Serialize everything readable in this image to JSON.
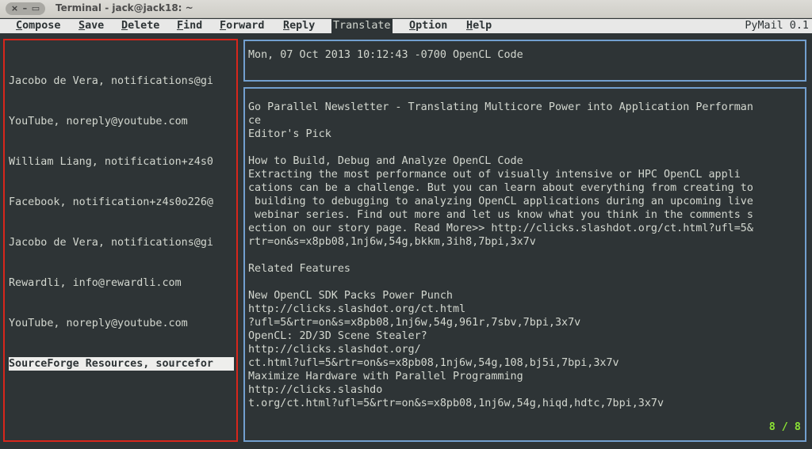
{
  "window": {
    "title": "Terminal - jack@jack18: ~",
    "buttons": {
      "close": "×",
      "minimize": "–",
      "maximize": "▭"
    }
  },
  "menubar": {
    "items": [
      {
        "first": "C",
        "rest": "ompose"
      },
      {
        "first": "S",
        "rest": "ave"
      },
      {
        "first": "D",
        "rest": "elete"
      },
      {
        "first": "F",
        "rest": "ind"
      },
      {
        "first": "F",
        "rest": "orward"
      },
      {
        "first": "R",
        "rest": "eply"
      },
      {
        "label": "Translate"
      },
      {
        "first": "O",
        "rest": "ption"
      },
      {
        "first": "H",
        "rest": "elp"
      }
    ],
    "app_name": "PyMail 0.1"
  },
  "inbox": {
    "items": [
      "Jacobo de Vera, notifications@gi",
      "YouTube, noreply@youtube.com",
      "William Liang, notification+z4s0",
      "Facebook, notification+z4s0o226@",
      "Jacobo de Vera, notifications@gi",
      "Rewardli, info@rewardli.com",
      "YouTube, noreply@youtube.com",
      "SourceForge Resources, sourcefor"
    ],
    "selected_index": 7
  },
  "message": {
    "header": "Mon, 07 Oct 2013 10:12:43 -0700 OpenCL Code",
    "body_lines": [
      "Go Parallel Newsletter - Translating Multicore Power into Application Performan",
      "ce",
      "Editor's Pick",
      "",
      "How to Build, Debug and Analyze OpenCL Code",
      "Extracting the most performance out of visually intensive or HPC OpenCL appli",
      "cations can be a challenge. But you can learn about everything from creating to",
      " building to debugging to analyzing OpenCL applications during an upcoming live",
      " webinar series. Find out more and let us know what you think in the comments s",
      "ection on our story page. Read More>> http://clicks.slashdot.org/ct.html?ufl=5&",
      "rtr=on&s=x8pb08,1nj6w,54g,bkkm,3ih8,7bpi,3x7v",
      "",
      "Related Features",
      "",
      "New OpenCL SDK Packs Power Punch",
      "http://clicks.slashdot.org/ct.html",
      "?ufl=5&rtr=on&s=x8pb08,1nj6w,54g,961r,7sbv,7bpi,3x7v",
      "OpenCL: 2D/3D Scene Stealer?",
      "http://clicks.slashdot.org/",
      "ct.html?ufl=5&rtr=on&s=x8pb08,1nj6w,54g,108,bj5i,7bpi,3x7v",
      "Maximize Hardware with Parallel Programming",
      "http://clicks.slashdo",
      "t.org/ct.html?ufl=5&rtr=on&s=x8pb08,1nj6w,54g,hiqd,hdtc,7bpi,3x7v"
    ],
    "page_indicator": "8 / 8"
  }
}
